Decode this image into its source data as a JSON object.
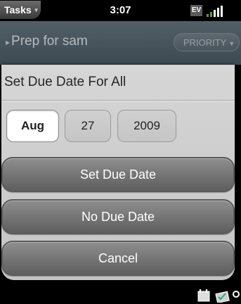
{
  "status_bar": {
    "app_name": "Tasks",
    "time": "3:07",
    "carrier_badge": "EV"
  },
  "task_header": {
    "title": "Prep for sam",
    "priority_label": "PRIORITY"
  },
  "dialog": {
    "title": "Set Due Date For All",
    "date": {
      "month": "Aug",
      "day": "27",
      "year": "2009",
      "selected_field": "month"
    },
    "buttons": {
      "set": "Set Due Date",
      "none": "No Due Date",
      "cancel": "Cancel"
    }
  },
  "colors": {
    "dialog_background": "#cfcfcf",
    "button_fill": "#767676",
    "header_background": "#4a555b"
  }
}
